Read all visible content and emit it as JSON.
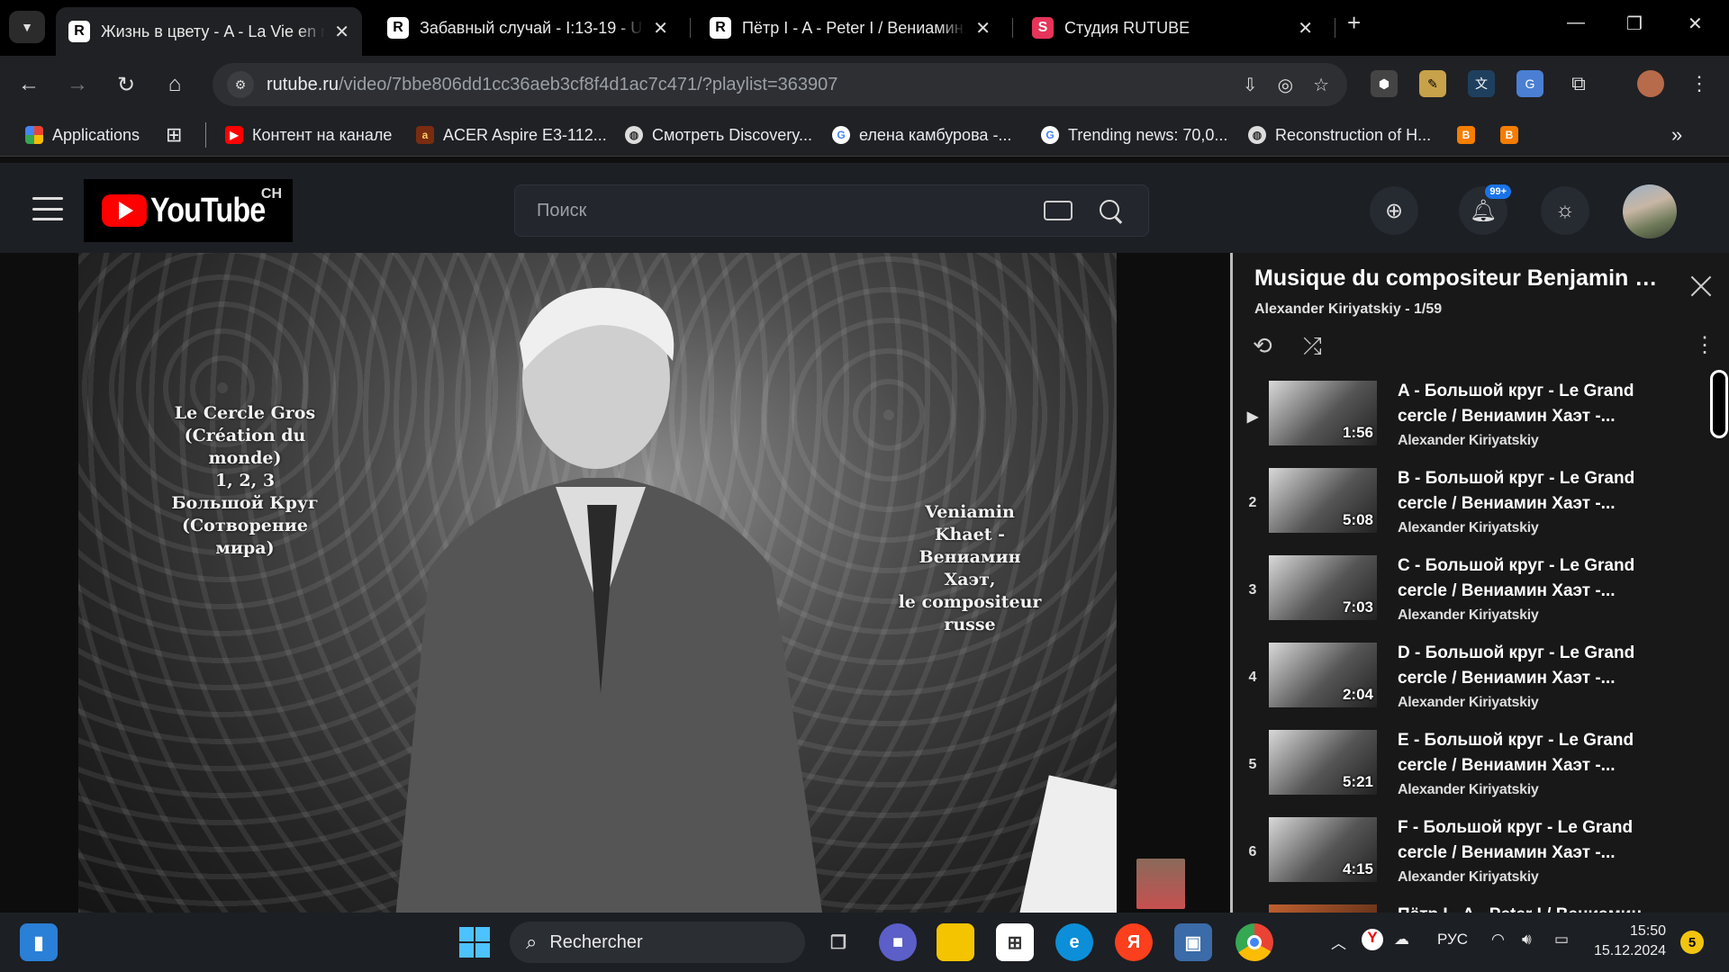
{
  "browser": {
    "tabs": [
      {
        "title": "Жизнь в цвету - A - La Vie en rose",
        "favicon": "R",
        "active": true
      },
      {
        "title": "Забавный случай - I:13-19 - Un",
        "favicon": "R",
        "active": false
      },
      {
        "title": "Пётр I - A - Peter I / Вениамин",
        "favicon": "R",
        "active": false
      },
      {
        "title": "Студия RUTUBE",
        "favicon": "S",
        "active": false
      }
    ],
    "url_host": "rutube.ru",
    "url_path": "/video/7bbe806dd1cc36aeb3cf8f4d1ac7c471/?playlist=363907",
    "bookmarks": [
      {
        "label": "Applications",
        "icon": "apps-grid-icon"
      },
      {
        "label": "Контент на канале",
        "icon": "youtube-icon"
      },
      {
        "label": "ACER Aspire E3-112...",
        "icon": "acer-icon"
      },
      {
        "label": "Смотреть Discovery...",
        "icon": "globe-icon"
      },
      {
        "label": "елена камбурова -...",
        "icon": "google-icon"
      },
      {
        "label": "Trending news: 70,0...",
        "icon": "google-icon"
      },
      {
        "label": "Reconstruction of H...",
        "icon": "globe-icon"
      }
    ],
    "more_bookmarks": "»"
  },
  "site": {
    "logo_text": "YouTube",
    "logo_region": "CH",
    "search_placeholder": "Поиск",
    "notif_badge": "99+"
  },
  "video": {
    "overlay_left": "Le Cercle Gros\n(Création du monde)\n1, 2, 3\nБольшой Круг\n(Сотворение мира)",
    "overlay_right": "Veniamin\nKhaet -\nВениамин\nХаэт,\nle compositeur russe"
  },
  "playlist": {
    "title": "Musique du compositeur Benjamin K...",
    "subtitle": "Alexander Kiriyatskiy - 1/59",
    "items": [
      {
        "index": "▶",
        "name": "A - Большой круг - Le Grand cercle / Вениамин Хаэт -...",
        "author": "Alexander Kiriyatskiy",
        "duration": "1:56"
      },
      {
        "index": "2",
        "name": "B - Большой круг - Le Grand cercle / Вениамин Хаэт -...",
        "author": "Alexander Kiriyatskiy",
        "duration": "5:08"
      },
      {
        "index": "3",
        "name": "C - Большой круг - Le Grand cercle / Вениамин Хаэт -...",
        "author": "Alexander Kiriyatskiy",
        "duration": "7:03"
      },
      {
        "index": "4",
        "name": "D - Большой круг - Le Grand cercle / Вениамин Хаэт -...",
        "author": "Alexander Kiriyatskiy",
        "duration": "2:04"
      },
      {
        "index": "5",
        "name": "E - Большой круг - Le Grand cercle / Вениамин Хаэт -...",
        "author": "Alexander Kiriyatskiy",
        "duration": "5:21"
      },
      {
        "index": "6",
        "name": "F - Большой круг - Le Grand cercle / Вениамин Хаэт -...",
        "author": "Alexander Kiriyatskiy",
        "duration": "4:15"
      },
      {
        "index": "",
        "name": "Пётр I - A - Peter I / Вениамин...",
        "author": "",
        "duration": ""
      }
    ]
  },
  "taskbar": {
    "search_label": "Rechercher",
    "lang": "РУС",
    "time": "15:50",
    "date": "15.12.2024",
    "notifications": "5"
  }
}
